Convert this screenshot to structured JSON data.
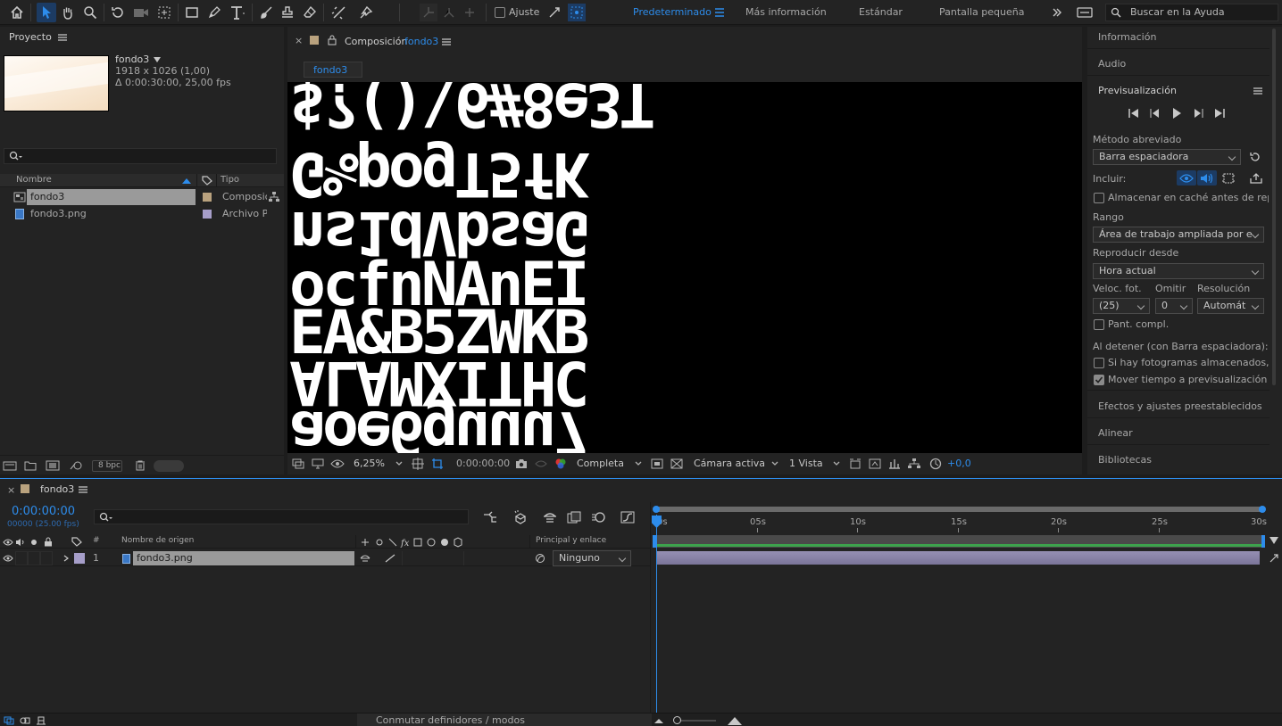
{
  "toolbar": {
    "snapping_label": "Ajuste",
    "workspaces": [
      "Predeterminado",
      "Más información",
      "Estándar",
      "Pantalla pequeña"
    ],
    "search_placeholder": "Buscar en la Ayuda"
  },
  "project": {
    "title": "Proyecto",
    "item_name": "fondo3",
    "item_dims": "1918 x 1026 (1,00)",
    "item_duration": "Δ 0:00:30:00, 25,00 fps",
    "columns": {
      "name": "Nombre",
      "type": "Tipo"
    },
    "rows": [
      {
        "name": "fondo3",
        "type": "Composición"
      },
      {
        "name": "fondo3.png",
        "type": "Archivo PNG"
      }
    ],
    "bpc": "8 bpc"
  },
  "composition": {
    "title_prefix": "Composición",
    "title_name": "fondo3",
    "tab": "fondo3",
    "glyph_rows": [
      "$?()\\6#8e3T",
      "G%pogT5fK",
      "ns1dVbsaG",
      "ocfnNAnEI",
      "EA&B5ZWKB",
      "ALAMXITHC",
      "aoe6guuu7"
    ],
    "zoom": "6,25%",
    "timecode": "0:00:00:00",
    "resolution": "Completa",
    "camera": "Cámara activa",
    "views": "1 Vista",
    "exposure": "+0,0"
  },
  "right_panels": {
    "info": "Información",
    "audio": "Audio",
    "preview": "Previsualización",
    "shortcut_label": "Método abreviado",
    "shortcut_value": "Barra espaciadora",
    "include_label": "Incluir:",
    "cache_label": "Almacenar en caché antes de reproducir",
    "range_label": "Rango",
    "range_value": "Área de trabajo ampliada por el tiempo actual",
    "playfrom_label": "Reproducir desde",
    "playfrom_value": "Hora actual",
    "fps_label": "Veloc. fot.",
    "skip_label": "Omitir",
    "res_label": "Resolución",
    "fps_value": "(25)",
    "skip_value": "0",
    "res_value": "Automática",
    "fullscreen_label": "Pant. compl.",
    "onstop_label": "Al detener (con Barra espaciadora):",
    "cached_label": "Si hay fotogramas almacenados, reproducir",
    "movetime_label": "Mover tiempo a previsualización",
    "effects": "Efectos y ajustes preestablecidos",
    "align": "Alinear",
    "libraries": "Bibliotecas"
  },
  "timeline": {
    "tab": "fondo3",
    "timecode": "0:00:00:00",
    "frames": "00000 (25.00 fps)",
    "col_hash": "#",
    "col_source": "Nombre de origen",
    "col_parent": "Principal y enlace",
    "layer_num": "1",
    "layer_name": "fondo3.png",
    "parent_value": "Ninguno",
    "ruler": [
      "0s",
      "05s",
      "10s",
      "15s",
      "20s",
      "25s",
      "30s"
    ],
    "bottom_label": "Conmutar definidores / modos"
  },
  "colors": {
    "accent": "#2d8ceb",
    "comp_label": "#b9a27e",
    "png_label": "#a69ec9",
    "layer_bar": "#8a84a8",
    "workarea": "#3da34d"
  }
}
